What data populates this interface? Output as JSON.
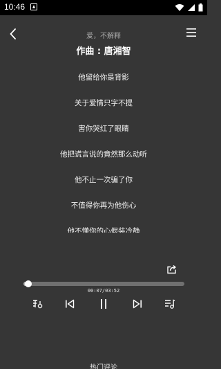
{
  "status_bar": {
    "time": "10:46"
  },
  "header": {
    "song_title": "爱，不解释",
    "composer": "作曲 : 唐湘智"
  },
  "lyrics": [
    "他留给你是背影",
    "关于爱情只字不提",
    "害你哭红了眼睛",
    "他把谎言说的竟然那么动听",
    "他不止一次骗了你",
    "不值得你再为他伤心",
    "他不懂你的心假装冷静"
  ],
  "player": {
    "current_time": "00:07",
    "total_time": "03:52",
    "time_display": "00:07/03:52",
    "progress_fraction": 0.03
  },
  "footer": {
    "comments_label": "热门评论"
  },
  "colors": {
    "background": "#363636",
    "progress_track": "#707070",
    "progress_fill": "#bdbdbd"
  }
}
